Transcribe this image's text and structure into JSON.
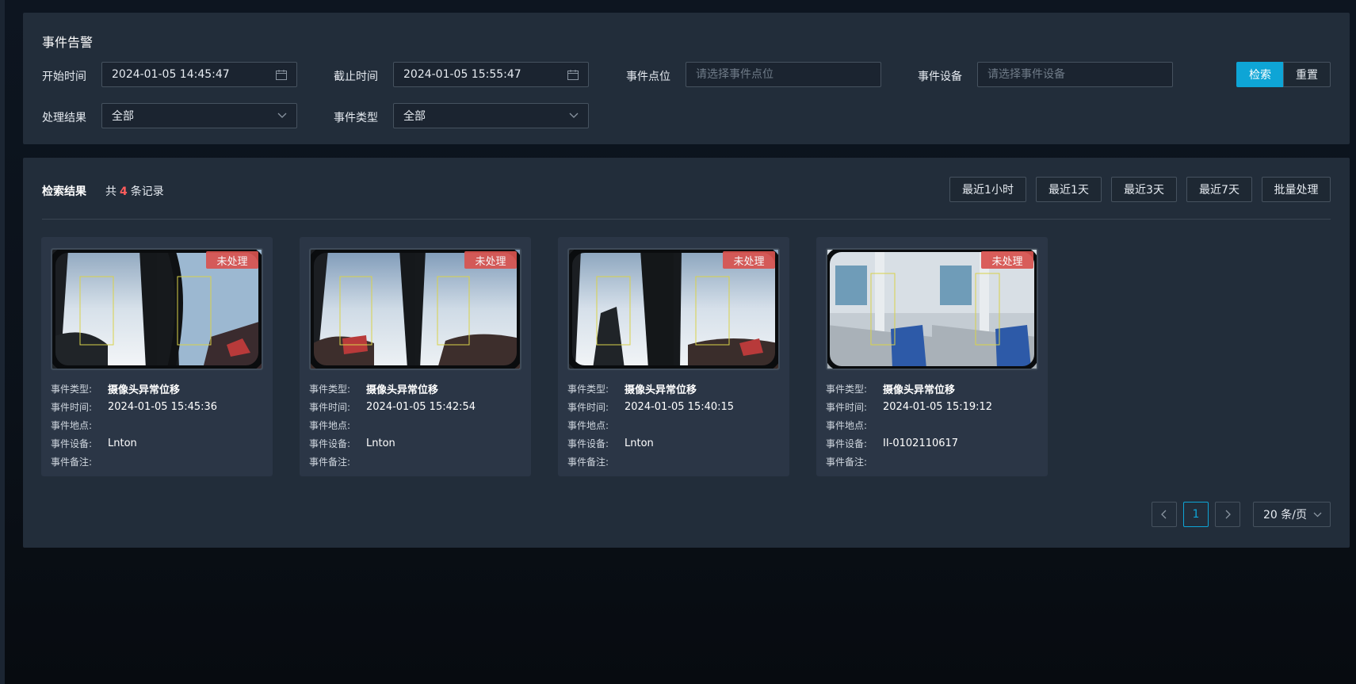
{
  "filter": {
    "title": "事件告警",
    "start_time": {
      "label": "开始时间",
      "value": "2024-01-05 14:45:47"
    },
    "end_time": {
      "label": "截止时间",
      "value": "2024-01-05 15:55:47"
    },
    "point": {
      "label": "事件点位",
      "placeholder": "请选择事件点位"
    },
    "device": {
      "label": "事件设备",
      "placeholder": "请选择事件设备"
    },
    "result": {
      "label": "处理结果",
      "value": "全部"
    },
    "type": {
      "label": "事件类型",
      "value": "全部"
    },
    "search_label": "检索",
    "reset_label": "重置",
    "accent": "#0ea5d6"
  },
  "results": {
    "title": "检索结果",
    "count_prefix": "共",
    "count": "4",
    "count_suffix": "条记录",
    "quick": [
      "最近1小时",
      "最近1天",
      "最近3天",
      "最近7天",
      "批量处理"
    ],
    "labels": {
      "type": "事件类型:",
      "time": "事件时间:",
      "place": "事件地点:",
      "device": "事件设备:",
      "remark": "事件备注:"
    },
    "cards": [
      {
        "status": "未处理",
        "type": "摄像头异常位移",
        "time": "2024-01-05 15:45:36",
        "place": "",
        "device": "Lnton",
        "remark": ""
      },
      {
        "status": "未处理",
        "type": "摄像头异常位移",
        "time": "2024-01-05 15:42:54",
        "place": "",
        "device": "Lnton",
        "remark": ""
      },
      {
        "status": "未处理",
        "type": "摄像头异常位移",
        "time": "2024-01-05 15:40:15",
        "place": "",
        "device": "Lnton",
        "remark": ""
      },
      {
        "status": "未处理",
        "type": "摄像头异常位移",
        "time": "2024-01-05 15:19:12",
        "place": "",
        "device": "II-0102110617",
        "remark": ""
      }
    ],
    "status_color": "#d9534f"
  },
  "pagination": {
    "current_page": "1",
    "page_size": "20 条/页"
  }
}
